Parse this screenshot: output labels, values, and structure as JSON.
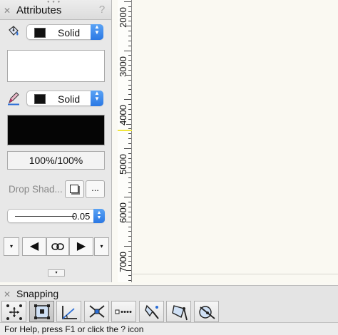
{
  "attributes_panel": {
    "title": "Attributes",
    "help_glyph": "?",
    "fill": {
      "icon": "fill-bucket-icon",
      "style": "Solid",
      "swatch_color": "#111111",
      "preview_color": "#ffffff"
    },
    "pen": {
      "icon": "pen-icon",
      "style": "Solid",
      "swatch_color": "#111111",
      "preview_color": "#050505"
    },
    "opacity": "100%/100%",
    "drop_shadow_label": "Drop Shad...",
    "drop_shadow_more": "...",
    "line_weight": "0.05",
    "arrows": {
      "start_menu": "▾",
      "start_arrow": "◀",
      "link": "⊝",
      "end_arrow": "▶",
      "end_menu": "▾"
    },
    "collapse": "▾"
  },
  "ruler": {
    "labels": [
      "2000",
      "3000",
      "4000",
      "5000",
      "6000",
      "7000"
    ]
  },
  "snapping_panel": {
    "title": "Snapping",
    "tools": [
      {
        "name": "snap-to-grid-icon",
        "active": false
      },
      {
        "name": "snap-to-object-icon",
        "active": true
      },
      {
        "name": "snap-to-angle-icon",
        "active": false
      },
      {
        "name": "snap-to-intersection-icon",
        "active": false
      },
      {
        "name": "snap-to-distance-icon",
        "active": false
      },
      {
        "name": "snap-to-tangent-icon",
        "active": false
      },
      {
        "name": "snap-to-point-icon",
        "active": false
      },
      {
        "name": "snap-to-surface-icon",
        "active": false
      }
    ]
  },
  "status_bar": {
    "text": "For Help, press F1 or click the ? icon"
  }
}
